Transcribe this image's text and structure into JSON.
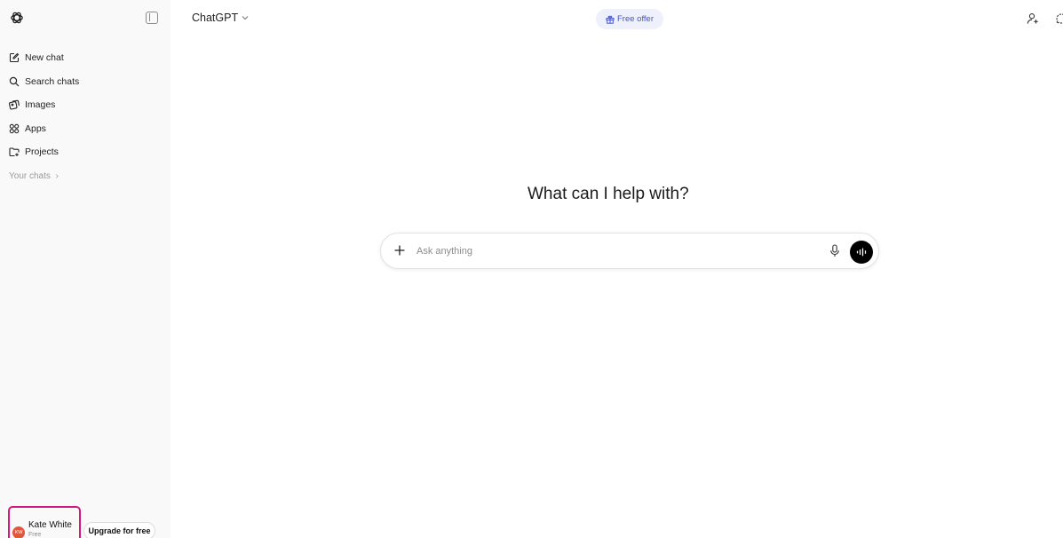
{
  "sidebar": {
    "items": [
      {
        "label": "New chat",
        "icon": "new-chat-icon"
      },
      {
        "label": "Search chats",
        "icon": "search-icon"
      },
      {
        "label": "Images",
        "icon": "images-icon"
      },
      {
        "label": "Apps",
        "icon": "apps-icon"
      },
      {
        "label": "Projects",
        "icon": "projects-icon"
      }
    ],
    "section_label": "Your chats",
    "user": {
      "initials": "KW",
      "name": "Kate White",
      "plan": "Free"
    },
    "upgrade_label": "Upgrade for free"
  },
  "header": {
    "model_name": "ChatGPT",
    "offer_label": "Free offer"
  },
  "main": {
    "headline": "What can I help with?",
    "composer_placeholder": "Ask anything"
  },
  "colors": {
    "highlight_border": "#d6197f",
    "offer_text": "#4a55c9",
    "offer_bg": "#eef0fb",
    "avatar_bg": "#e0573c"
  }
}
